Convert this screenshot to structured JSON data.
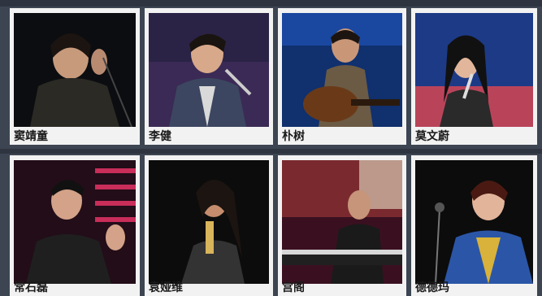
{
  "artists": [
    {
      "name": "窦靖童"
    },
    {
      "name": "李健"
    },
    {
      "name": "朴树"
    },
    {
      "name": "莫文蔚"
    },
    {
      "name": "常石磊"
    },
    {
      "name": "袁娅维"
    },
    {
      "name": "宫阁"
    },
    {
      "name": "德德玛"
    }
  ],
  "colors": {
    "frame": "#3d4552",
    "card": "#f2f2f2",
    "label": "#1a1a1a"
  }
}
